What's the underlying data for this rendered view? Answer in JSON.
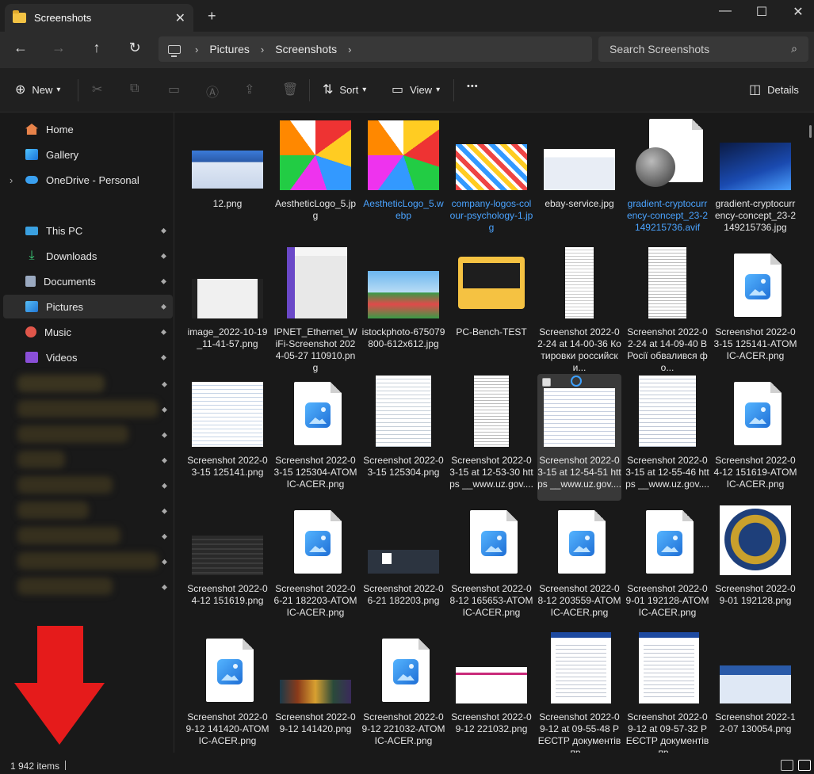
{
  "window": {
    "tab_title": "Screenshots",
    "new_tab": "+",
    "tab_close": "✕",
    "minimize": "—",
    "maximize": "☐",
    "close": "✕"
  },
  "nav": {
    "back": "←",
    "forward": "→",
    "up": "↑",
    "refresh": "↻"
  },
  "address": {
    "segments": [
      "Pictures",
      "Screenshots"
    ],
    "sep": "›"
  },
  "search": {
    "placeholder": "Search Screenshots",
    "icon": "⌕"
  },
  "toolbar": {
    "new": "New",
    "new_chev": "⌄",
    "sort": "Sort",
    "view": "View",
    "more": "•••",
    "details": "Details"
  },
  "sidebar": {
    "home": "Home",
    "gallery": "Gallery",
    "onedrive": "OneDrive - Personal",
    "onedrive_chev": "›",
    "thispc": "This PC",
    "downloads": "Downloads",
    "documents": "Documents",
    "pictures": "Pictures",
    "music": "Music",
    "videos": "Videos",
    "pin": "📌"
  },
  "colors": {
    "accent": "#4aa3ff",
    "selected": "#2d2d2d",
    "arrow": "#e51b1b"
  },
  "files": [
    [
      "12.png"
    ],
    [
      "AestheticLogo_5.jpg"
    ],
    [
      "AestheticLogo_5.webp"
    ],
    [
      "company-logos-colour-psychology-1.jpg"
    ],
    [
      "ebay-service.jpg"
    ],
    [
      "gradient-cryptocurrency-concept_23-2149215736.avif"
    ],
    [
      "gradient-cryptocurrency-concept_23-2149215736.jpg"
    ],
    [
      "image_2022-10-19_11-41-57.png"
    ],
    [
      "IPNET_Ethernet_WiFi-Screenshot 2024-05-27 110910.png"
    ],
    [
      "istockphoto-675079800-612x612.jpg"
    ],
    [
      "PC-Bench-TEST"
    ],
    [
      "Screenshot 2022-02-24 at 14-00-36 Котировки российски..."
    ],
    [
      "Screenshot 2022-02-24 at 14-09-40 В Росії обвалився фо..."
    ],
    [
      "Screenshot 2022-03-15 125141-ATOMIC-ACER.png"
    ],
    [
      "Screenshot 2022-03-15 125141.png"
    ],
    [
      "Screenshot 2022-03-15 125304-ATOMIC-ACER.png"
    ],
    [
      "Screenshot 2022-03-15 125304.png"
    ],
    [
      "Screenshot 2022-03-15 at 12-53-30 https __www.uz.gov...."
    ],
    [
      "Screenshot 2022-03-15 at 12-54-51 https __www.uz.gov...."
    ],
    [
      "Screenshot 2022-03-15 at 12-55-46 https __www.uz.gov...."
    ],
    [
      "Screenshot 2022-04-12 151619-ATOMIC-ACER.png"
    ],
    [
      "Screenshot 2022-04-12 151619.png"
    ],
    [
      "Screenshot 2022-06-21 182203-ATOMIC-ACER.png"
    ],
    [
      "Screenshot 2022-06-21 182203.png"
    ],
    [
      "Screenshot 2022-08-12 165653-ATOMIC-ACER.png"
    ],
    [
      "Screenshot 2022-08-12 203559-ATOMIC-ACER.png"
    ],
    [
      "Screenshot 2022-09-01 192128-ATOMIC-ACER.png"
    ],
    [
      "Screenshot 2022-09-01 192128.png"
    ],
    [
      "Screenshot 2022-09-12 141420-ATOMIC-ACER.png"
    ],
    [
      "Screenshot 2022-09-12 141420.png"
    ],
    [
      "Screenshot 2022-09-12 221032-ATOMIC-ACER.png"
    ],
    [
      "Screenshot 2022-09-12 221032.png"
    ],
    [
      "Screenshot 2022-09-12 at 09-55-48 РЕЄСТР документів пр..."
    ],
    [
      "Screenshot 2022-09-12 at 09-57-32 РЕЄСТР документів пр..."
    ],
    [
      "Screenshot 2022-12-07 130054.png"
    ]
  ],
  "file_names": {
    "f0": "12.png",
    "f1": "AestheticLogo_5.jpg",
    "f2": "AestheticLogo_5.webp",
    "f3": "company-logos-colour-psychology-1.jpg",
    "f4": "ebay-service.jpg",
    "f5": "gradient-cryptocurrency-concept_23-2149215736.avif",
    "f6": "gradient-cryptocurrency-concept_23-2149215736.jpg",
    "f7": "image_2022-10-19_11-41-57.png",
    "f8": "IPNET_Ethernet_WiFi-Screenshot 2024-05-27 110910.png",
    "f9": "istockphoto-675079800-612x612.jpg",
    "f10": "PC-Bench-TEST",
    "f11": "Screenshot 2022-02-24 at 14-00-36 Котировки российски...",
    "f12": "Screenshot 2022-02-24 at 14-09-40 В Росії обвалився фо...",
    "f13": "Screenshot 2022-03-15 125141-ATOMIC-ACER.png",
    "f14": "Screenshot 2022-03-15 125141.png",
    "f15": "Screenshot 2022-03-15 125304-ATOMIC-ACER.png",
    "f16": "Screenshot 2022-03-15 125304.png",
    "f17": "Screenshot 2022-03-15 at 12-53-30 https __www.uz.gov....",
    "f18": "Screenshot 2022-03-15 at 12-54-51 https __www.uz.gov....",
    "f19": "Screenshot 2022-03-15 at 12-55-46 https __www.uz.gov....",
    "f20": "Screenshot 2022-04-12 151619-ATOMIC-ACER.png",
    "f21": "Screenshot 2022-04-12 151619.png",
    "f22": "Screenshot 2022-06-21 182203-ATOMIC-ACER.png",
    "f23": "Screenshot 2022-06-21 182203.png",
    "f24": "Screenshot 2022-08-12 165653-ATOMIC-ACER.png",
    "f25": "Screenshot 2022-08-12 203559-ATOMIC-ACER.png",
    "f26": "Screenshot 2022-09-01 192128-ATOMIC-ACER.png",
    "f27": "Screenshot 2022-09-01 192128.png",
    "f28": "Screenshot 2022-09-12 141420-ATOMIC-ACER.png",
    "f29": "Screenshot 2022-09-12 141420.png",
    "f30": "Screenshot 2022-09-12 221032-ATOMIC-ACER.png",
    "f31": "Screenshot 2022-09-12 221032.png",
    "f32": "Screenshot 2022-09-12 at 09-55-48 РЕЄСТР документів пр...",
    "f33": "Screenshot 2022-09-12 at 09-57-32 РЕЄСТР документів пр...",
    "f34": "Screenshot 2022-12-07 130054.png"
  },
  "status": {
    "count": "1 942 items",
    "cursor": "|"
  }
}
